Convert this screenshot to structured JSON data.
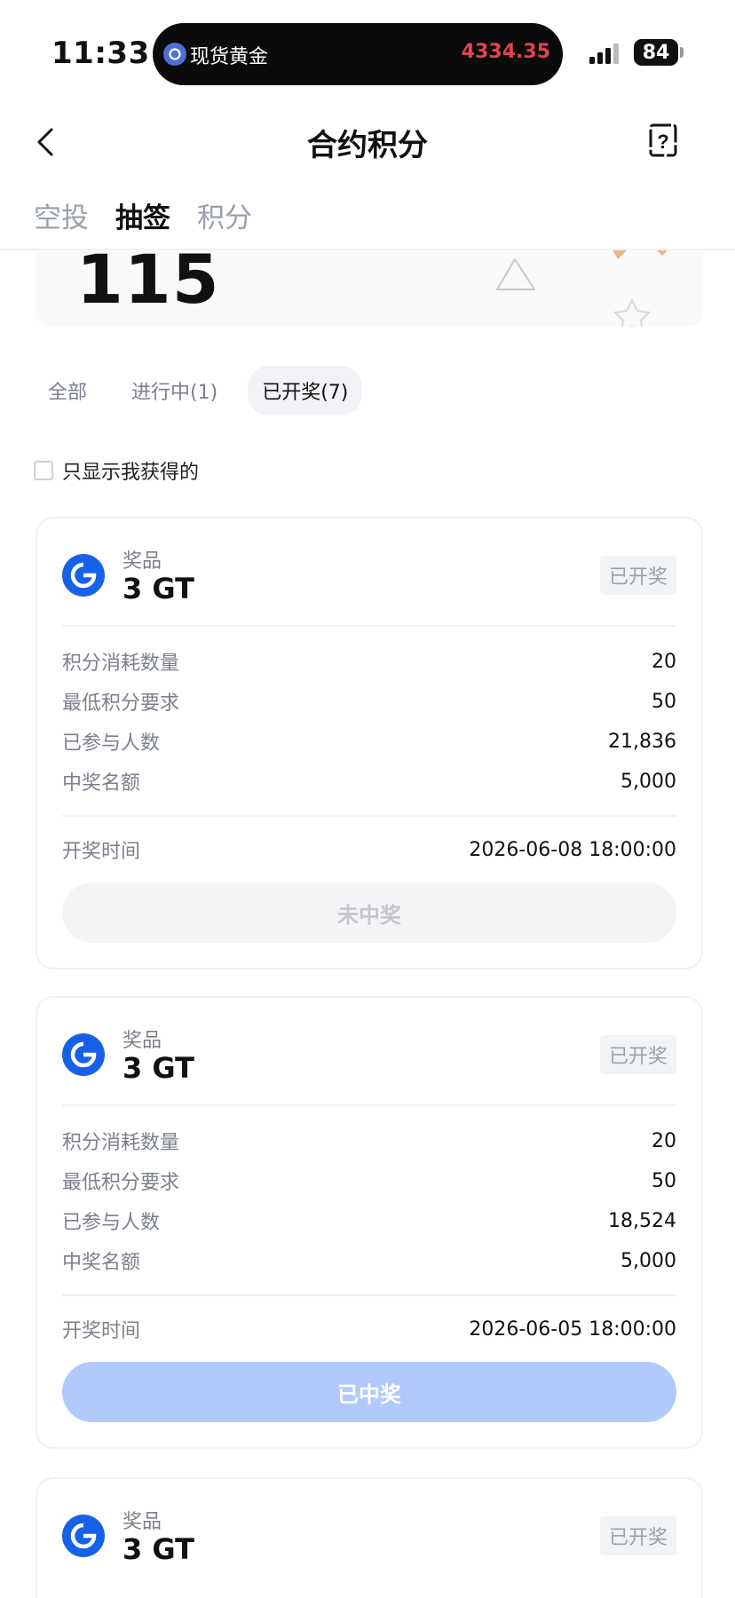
{
  "status_bar": {
    "time": "11:33",
    "island_label": "现货黄金",
    "island_price": "4334.35",
    "battery": "84"
  },
  "nav": {
    "title": "合约积分"
  },
  "tabs": [
    {
      "label": "空投",
      "active": false
    },
    {
      "label": "抽签",
      "active": true
    },
    {
      "label": "积分",
      "active": false
    }
  ],
  "points": {
    "value": "115"
  },
  "filters": [
    {
      "label": "全部",
      "active": false
    },
    {
      "label": "进行中(1)",
      "active": false
    },
    {
      "label": "已开奖(7)",
      "active": true
    }
  ],
  "checkbox": {
    "label": "只显示我获得的"
  },
  "cards": [
    {
      "prize_label": "奖品",
      "prize": "3 GT",
      "status": "已开奖",
      "rows": [
        {
          "label": "积分消耗数量",
          "value": "20"
        },
        {
          "label": "最低积分要求",
          "value": "50"
        },
        {
          "label": "已参与人数",
          "value": "21,836"
        },
        {
          "label": "中奖名额",
          "value": "5,000"
        }
      ],
      "draw_time_label": "开奖时间",
      "draw_time": "2026-06-08 18:00:00",
      "result": "未中奖"
    },
    {
      "prize_label": "奖品",
      "prize": "3 GT",
      "status": "已开奖",
      "rows": [
        {
          "label": "积分消耗数量",
          "value": "20"
        },
        {
          "label": "最低积分要求",
          "value": "50"
        },
        {
          "label": "已参与人数",
          "value": "18,524"
        },
        {
          "label": "中奖名额",
          "value": "5,000"
        }
      ],
      "draw_time_label": "开奖时间",
      "draw_time": "2026-06-05 18:00:00",
      "result": "已中奖"
    },
    {
      "prize_label": "奖品",
      "prize": "3 GT",
      "status": "已开奖"
    }
  ],
  "colors": {
    "accent": "#1760e8",
    "won_button": "#b1c9fb",
    "price_red": "#e0444f"
  }
}
